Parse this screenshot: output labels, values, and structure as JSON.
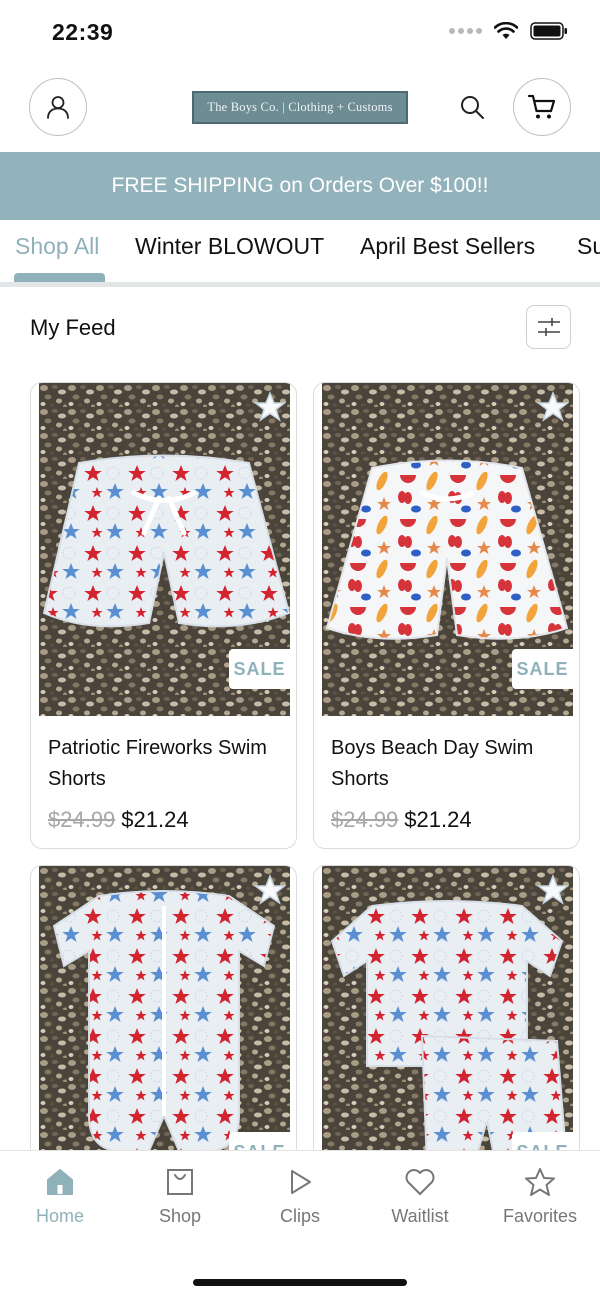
{
  "status_bar": {
    "time": "22:39"
  },
  "header": {
    "logo_text": "The Boys Co. | Clothing + Customs",
    "icons": {
      "account": "account-icon",
      "search": "search-icon",
      "cart": "cart-icon"
    }
  },
  "banner": {
    "text": "FREE SHIPPING on Orders Over $100!!"
  },
  "tabs": [
    {
      "label": "Shop All",
      "active": true
    },
    {
      "label": "Winter BLOWOUT",
      "active": false
    },
    {
      "label": "April Best Sellers",
      "active": false
    },
    {
      "label": "Su",
      "active": false
    }
  ],
  "feed": {
    "title": "My Feed",
    "filter_icon": "sliders-icon",
    "products": [
      {
        "title": "Patriotic Fireworks Swim Shorts",
        "price_old": "$24.99",
        "price_new": "$21.24",
        "badge": "SALE"
      },
      {
        "title": "Boys Beach Day Swim Shorts",
        "price_old": "$24.99",
        "price_new": "$21.24",
        "badge": "SALE"
      },
      {
        "title": "",
        "price_old": "",
        "price_new": "",
        "badge": "SALE"
      },
      {
        "title": "",
        "price_old": "",
        "price_new": "",
        "badge": "SALE"
      }
    ]
  },
  "bottom_nav": [
    {
      "label": "Home",
      "icon": "home-icon",
      "active": true
    },
    {
      "label": "Shop",
      "icon": "shopping-bag-icon",
      "active": false
    },
    {
      "label": "Clips",
      "icon": "play-icon",
      "active": false
    },
    {
      "label": "Waitlist",
      "icon": "heart-icon",
      "active": false
    },
    {
      "label": "Favorites",
      "icon": "star-icon",
      "active": false
    }
  ],
  "colors": {
    "accent": "#8fb1ba",
    "banner": "#93b3bc",
    "logo_bg": "#6e8c94"
  }
}
